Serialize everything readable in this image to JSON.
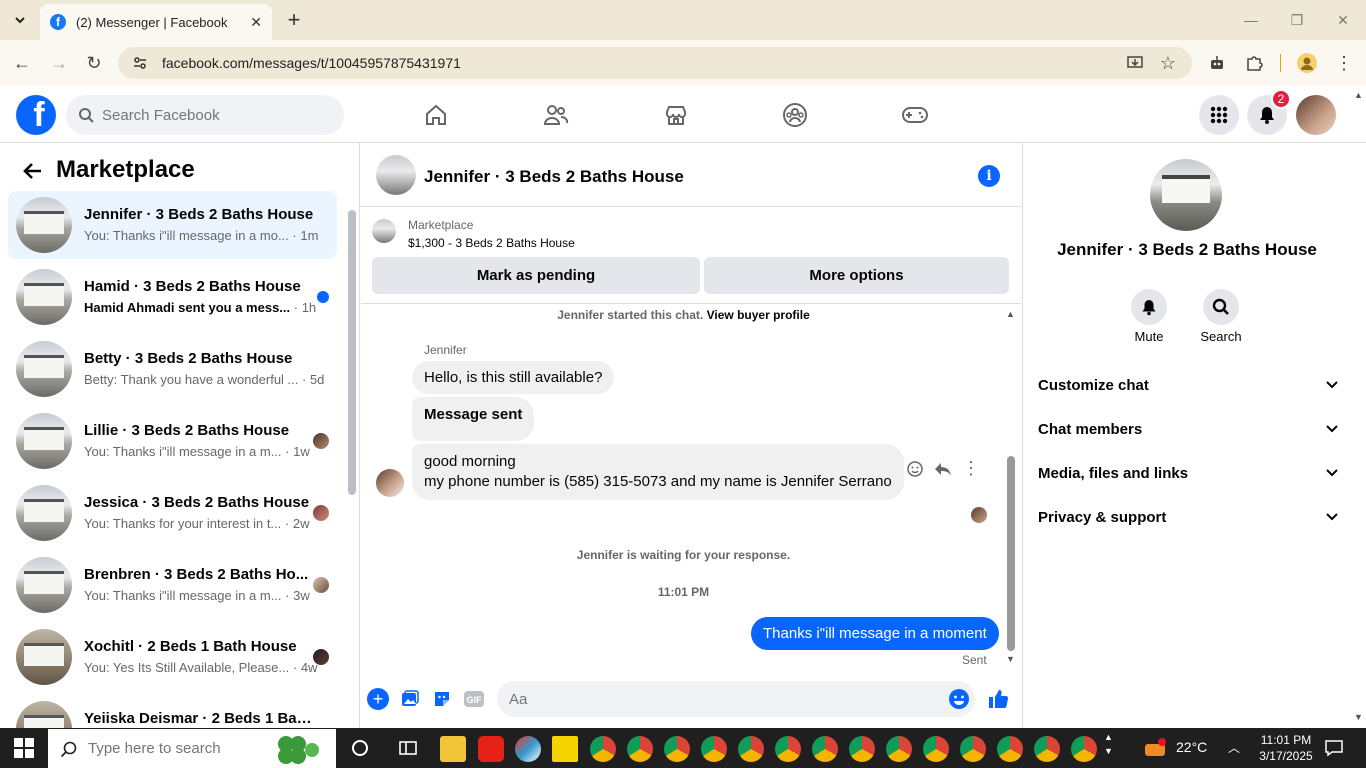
{
  "browser": {
    "tab_title": "(2) Messenger | Facebook",
    "url": "facebook.com/messages/t/10045957875431971"
  },
  "fb": {
    "search_placeholder": "Search Facebook",
    "notif_count": "2",
    "brand_color": "#0866ff"
  },
  "marketplace": {
    "title": "Marketplace",
    "conversations": [
      {
        "name": "Jennifer · 3 Beds 2 Baths House",
        "snippet": "You: Thanks i\"ill message in a mo...",
        "time": "· 1m",
        "active": true
      },
      {
        "name": "Hamid · 3 Beds 2 Baths House",
        "snippet": "Hamid Ahmadi sent you a mess...",
        "time": "· 1h",
        "unread": true
      },
      {
        "name": "Betty · 3 Beds 2 Baths House",
        "snippet": "Betty: Thank you have a wonderful ...",
        "time": "· 5d"
      },
      {
        "name": "Lillie · 3 Beds 2 Baths House",
        "snippet": "You: Thanks i\"ill message in a m...",
        "time": "· 1w"
      },
      {
        "name": "Jessica · 3 Beds 2 Baths House",
        "snippet": "You: Thanks for your interest in t...",
        "time": "· 2w"
      },
      {
        "name": "Brenbren · 3 Beds 2 Baths Ho...",
        "snippet": "You: Thanks i\"ill message in a m...",
        "time": "· 3w"
      },
      {
        "name": "Xochitl · 2 Beds 1 Bath House",
        "snippet": "You: Yes Its Still Available, Please...",
        "time": "· 4w"
      },
      {
        "name": "Yeiiska Deismar · 2 Beds 1 Bat...",
        "snippet": "",
        "time": ""
      }
    ]
  },
  "chat": {
    "header_name": "Jennifer · 3 Beds 2 Baths House",
    "listing_category": "Marketplace",
    "listing_title": "$1,300 - 3 Beds 2 Baths House",
    "btn_pending": "Mark as pending",
    "btn_more": "More options",
    "started_text": "Jennifer started this chat.",
    "view_profile": "View buyer profile",
    "sender_label": "Jennifer",
    "msg1": "Hello, is this still available?",
    "msg2": "Message sent",
    "msg3_line1": "good morning",
    "msg3_line2": "my phone number is (585) 315-5073 and my name is Jennifer Serrano",
    "waiting": "Jennifer is waiting for your response.",
    "timestamp": "11:01 PM",
    "my_msg": "Thanks i\"ill message in a moment",
    "sent_status": "Sent",
    "composer_placeholder": "Aa"
  },
  "details": {
    "name": "Jennifer · 3 Beds 2 Baths House",
    "mute": "Mute",
    "search": "Search",
    "sections": [
      "Customize chat",
      "Chat members",
      "Media, files and links",
      "Privacy & support"
    ]
  },
  "taskbar": {
    "search_placeholder": "Type here to search",
    "temperature": "22°C",
    "time": "11:01 PM",
    "date": "3/17/2025"
  }
}
